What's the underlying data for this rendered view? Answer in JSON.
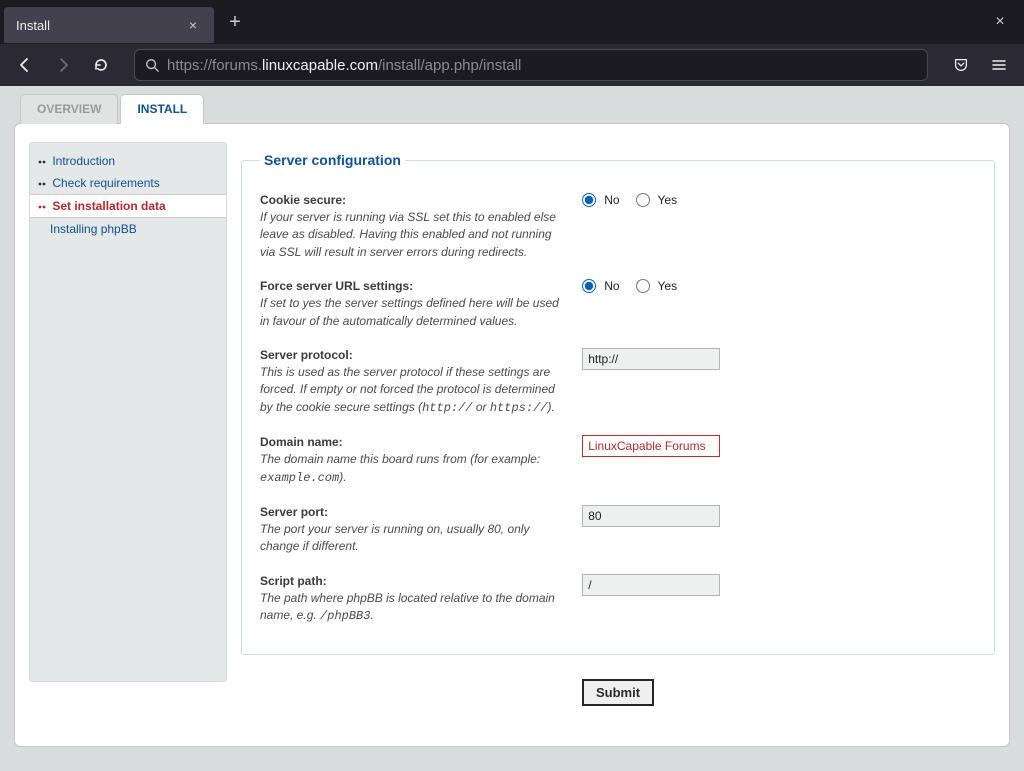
{
  "browser": {
    "tab_title": "Install",
    "url_prefix": "https://forums.",
    "url_bold": "linuxcapable.com",
    "url_suffix": "/install/app.php/install"
  },
  "tabs": {
    "overview": "OVERVIEW",
    "install": "INSTALL"
  },
  "sidebar": {
    "introduction": "Introduction",
    "check_requirements": "Check requirements",
    "set_installation_data": "Set installation data",
    "installing_phpbb": "Installing phpBB"
  },
  "server_config": {
    "legend": "Server configuration",
    "cookie_secure": {
      "label": "Cookie secure:",
      "desc": "If your server is running via SSL set this to enabled else leave as disabled. Having this enabled and not running via SSL will result in server errors during redirects.",
      "no": "No",
      "yes": "Yes"
    },
    "force_server": {
      "label": "Force server URL settings:",
      "desc": "If set to yes the server settings defined here will be used in favour of the automatically determined values.",
      "no": "No",
      "yes": "Yes"
    },
    "protocol": {
      "label": "Server protocol:",
      "desc_pre": "This is used as the server protocol if these settings are forced. If empty or not forced the protocol is determined by the cookie secure settings (",
      "code1": "http://",
      "or": " or ",
      "code2": "https://",
      "desc_post": ").",
      "value": "http://"
    },
    "domain": {
      "label": "Domain name:",
      "desc_pre": "The domain name this board runs from (for example: ",
      "code": "example.com",
      "desc_post": ").",
      "value": "LinuxCapable Forums"
    },
    "port": {
      "label": "Server port:",
      "desc": "The port your server is running on, usually 80, only change if different.",
      "value": "80"
    },
    "script_path": {
      "label": "Script path:",
      "desc_pre": "The path where phpBB is located relative to the domain name, e.g. ",
      "code": "/phpBB3",
      "desc_post": ".",
      "value": "/"
    }
  },
  "submit_label": "Submit"
}
